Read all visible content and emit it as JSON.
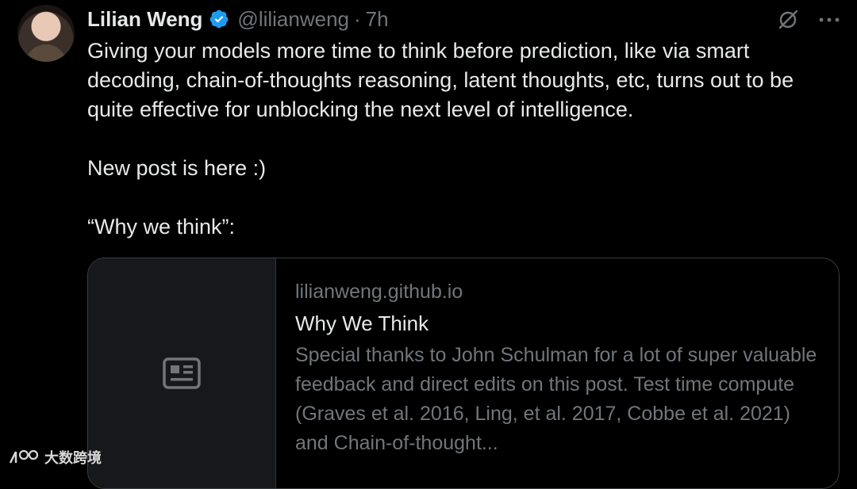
{
  "author": {
    "name": "Lilian Weng",
    "handle": "@lilianweng",
    "separator": "·",
    "time": "7h"
  },
  "tweet": {
    "text": "Giving your models more time to think before prediction, like via smart decoding, chain-of-thoughts reasoning, latent thoughts, etc, turns out to be quite effective for unblocking the next level of intelligence.\n\nNew post is here :)\n\n“Why we think”:"
  },
  "card": {
    "domain": "lilianweng.github.io",
    "title": "Why We Think",
    "description": "Special thanks to John Schulman for a lot of super valuable feedback and direct edits on this post. Test time compute (Graves et al. 2016, Ling, et al. 2017, Cobbe et al. 2021) and Chain-of-thought..."
  },
  "watermark": {
    "text": "大数跨境"
  },
  "colors": {
    "background": "#000000",
    "text": "#e7e9ea",
    "muted": "#71767b",
    "verified": "#1d9bf0"
  },
  "icons": [
    "verified-badge-icon",
    "grok-icon",
    "more-icon",
    "article-icon"
  ]
}
